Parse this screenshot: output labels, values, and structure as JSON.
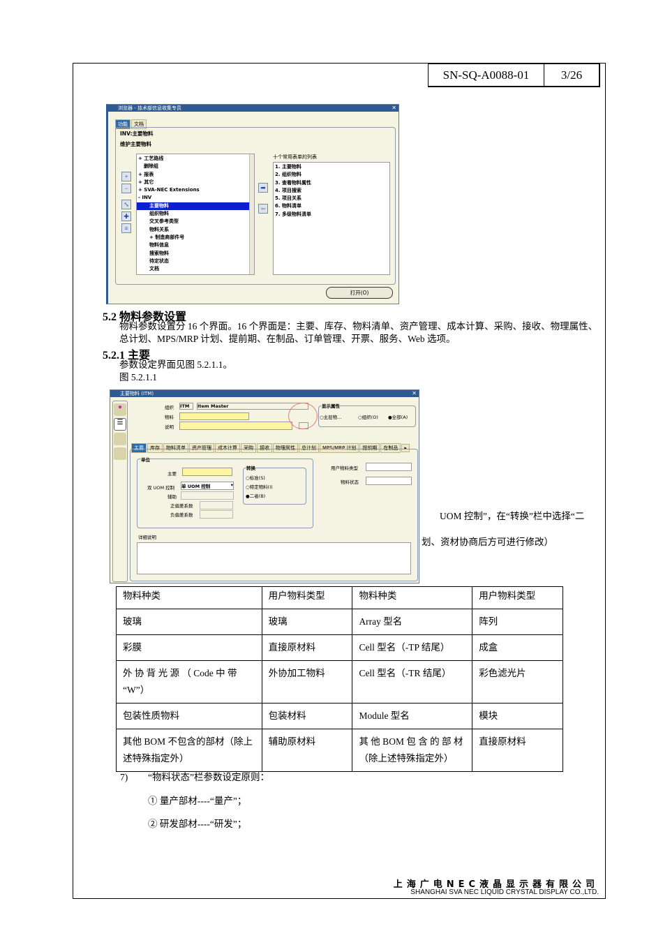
{
  "header": {
    "doc_no": "SN-SQ-A0088-01",
    "page": "3/26"
  },
  "navigator": {
    "title": "浏览器 - 技术部信息收集专员",
    "tabs": [
      "功能",
      "文档"
    ],
    "heading1": "INV:主要物料",
    "heading2": "维护主要物料",
    "tree": [
      "+ 工艺路线",
      "删除组",
      "+ 报表",
      "+ 其它",
      "+ SVA-NEC Extensions",
      "- INV",
      "主要物料",
      "组织物料",
      "交叉参考类型",
      "物料关系",
      "+ 制造商部件号",
      "物料信息",
      "搜索物料",
      "待定状态",
      "文档"
    ],
    "tree_selected": 6,
    "top_list_label": "十个常用表单的列表",
    "top_list": [
      "1. 主要物料",
      "2. 组织物料",
      "3. 查看物料属性",
      "4. 项目搜索",
      "5. 项目关系",
      "6. 物料清单",
      "7. 多级物料清单"
    ],
    "open_button": "打开(O)"
  },
  "section_52": {
    "title": "5.2 物料参数设置",
    "text": "物料参数设置分 16 个界面。16 个界面是：主要、库存、物料清单、资产管理、成本计算、采购、接收、物理属性、总计划、MPS/MRP 计划、提前期、在制品、订单管理、开票、服务、Web 选项。"
  },
  "section_521": {
    "title": "5.2.1 主要",
    "text": "参数设定界面见图 5.2.1.1。",
    "figure": "图 5.2.1.1"
  },
  "item_form": {
    "title": "主要物料 (ITM)",
    "org_label": "组织",
    "org_code": "ITM",
    "org_name": "Item Master",
    "item_label": "物料",
    "desc_label": "说明",
    "display_attr": "显示属性",
    "radio_master": "主层物...",
    "radio_org": "组织(O)",
    "radio_all": "全部(A)",
    "tabs": [
      "主要",
      "库存",
      "物料清单",
      "资产管理",
      "成本计算",
      "采购",
      "接收",
      "物理属性",
      "总计划",
      "MPS/MRP 计划",
      "提前期",
      "在制品"
    ],
    "unit_group": "单位",
    "primary_label": "主要",
    "dual_uom_label": "双 UOM 控制",
    "dual_uom_value": "单 UOM 控制",
    "secondary_label": "辅助",
    "pos_dev": "正偏差系数",
    "neg_dev": "负偏差系数",
    "conv_group": "转换",
    "conv_std": "标准(S)",
    "conv_item": "特定物料(I)",
    "conv_both": "二者(B)",
    "user_item_type": "用户物料类型",
    "item_status": "物料状态",
    "long_desc": "详细说明"
  },
  "overflow_text": [
    "UOM 控制”，在“转换”栏中选择“二",
    "划、资材协商后方可进行修改）"
  ],
  "table": {
    "rows": [
      [
        "物料种类",
        "用户物料类型",
        "物料种类",
        "用户物料类型"
      ],
      [
        "玻璃",
        "玻璃",
        "Array 型名",
        "阵列"
      ],
      [
        "彩膜",
        "直接原材料",
        "Cell 型名（-TP 结尾）",
        "成盒"
      ],
      [
        "外 协 背 光 源 （ Code 中 带 “W”）",
        "外协加工物料",
        "Cell 型名（-TR 结尾）",
        "彩色滤光片"
      ],
      [
        "包装性质物料",
        "包装材料",
        "Module 型名",
        "模块"
      ],
      [
        "其他 BOM 不包含的部材（除上述特殊指定外）",
        "辅助原材料",
        "其 他 BOM 包 含 的 部 材（除上述特殊指定外）",
        "直接原材料"
      ]
    ]
  },
  "item7": {
    "num": "7)",
    "text": "“物料状态”栏参数设定原则：",
    "l1": "① 量产部材----“量产”；",
    "l2": "② 研发部材----“研发”；"
  },
  "footer": {
    "cn": "上海广电NEC液晶显示器有限公司",
    "en": "SHANGHAI SVA NEC LIQUID CRYSTAL DISPLAY CO.,LTD."
  }
}
